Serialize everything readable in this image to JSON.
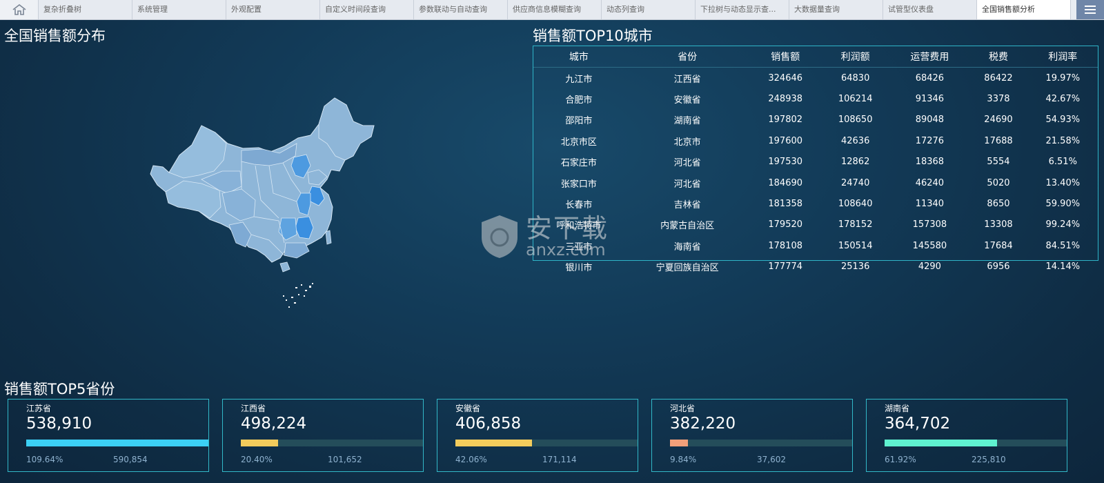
{
  "tabs": [
    {
      "label": "复杂折叠树",
      "active": false
    },
    {
      "label": "系统管理",
      "active": false
    },
    {
      "label": "外观配置",
      "active": false
    },
    {
      "label": "自定义时间段查询",
      "active": false
    },
    {
      "label": "参数联动与自动查询",
      "active": false
    },
    {
      "label": "供应商信息模糊查询",
      "active": false
    },
    {
      "label": "动态列查询",
      "active": false
    },
    {
      "label": "下拉树与动态显示查...",
      "active": false
    },
    {
      "label": "大数据量查询",
      "active": false
    },
    {
      "label": "试管型仪表盘",
      "active": false
    },
    {
      "label": "全国销售额分析",
      "active": true
    }
  ],
  "map_section": {
    "title": "全国销售额分布"
  },
  "table_section": {
    "title": "销售额TOP10城市",
    "columns": [
      "城市",
      "省份",
      "销售额",
      "利润额",
      "运营费用",
      "税费",
      "利润率"
    ],
    "rows": [
      [
        "九江市",
        "江西省",
        "324646",
        "64830",
        "68426",
        "86422",
        "19.97%"
      ],
      [
        "合肥市",
        "安徽省",
        "248938",
        "106214",
        "91346",
        "3378",
        "42.67%"
      ],
      [
        "邵阳市",
        "湖南省",
        "197802",
        "108650",
        "89048",
        "24690",
        "54.93%"
      ],
      [
        "北京市区",
        "北京市",
        "197600",
        "42636",
        "17276",
        "17688",
        "21.58%"
      ],
      [
        "石家庄市",
        "河北省",
        "197530",
        "12862",
        "18368",
        "5554",
        "6.51%"
      ],
      [
        "张家口市",
        "河北省",
        "184690",
        "24740",
        "46240",
        "5020",
        "13.40%"
      ],
      [
        "长春市",
        "吉林省",
        "181358",
        "108640",
        "11340",
        "8650",
        "59.90%"
      ],
      [
        "呼和浩特市",
        "内蒙古自治区",
        "179520",
        "178152",
        "157308",
        "13308",
        "99.24%"
      ],
      [
        "三亚市",
        "海南省",
        "178108",
        "150514",
        "145580",
        "17684",
        "84.51%"
      ],
      [
        "银川市",
        "宁夏回族自治区",
        "177774",
        "25136",
        "4290",
        "6956",
        "14.14%"
      ]
    ]
  },
  "cards_section": {
    "title": "销售额TOP5省份",
    "cards": [
      {
        "name": "江苏省",
        "value": "538,910",
        "pct": "109.64%",
        "total": "590,854",
        "fill": 1.0,
        "color": "#3cd0f5"
      },
      {
        "name": "江西省",
        "value": "498,224",
        "pct": "20.40%",
        "total": "101,652",
        "fill": 0.204,
        "color": "#f3cc5c"
      },
      {
        "name": "安徽省",
        "value": "406,858",
        "pct": "42.06%",
        "total": "171,114",
        "fill": 0.4206,
        "color": "#f3cc5c"
      },
      {
        "name": "河北省",
        "value": "382,220",
        "pct": "9.84%",
        "total": "37,602",
        "fill": 0.0984,
        "color": "#f2a07a"
      },
      {
        "name": "湖南省",
        "value": "364,702",
        "pct": "61.92%",
        "total": "225,810",
        "fill": 0.6192,
        "color": "#5ff2d0"
      }
    ]
  },
  "watermark": {
    "text": "安下载",
    "sub": "anxz.com"
  },
  "icons": {
    "home": "home-icon",
    "menu": "menu-icon",
    "watermark": "shield-icon"
  }
}
